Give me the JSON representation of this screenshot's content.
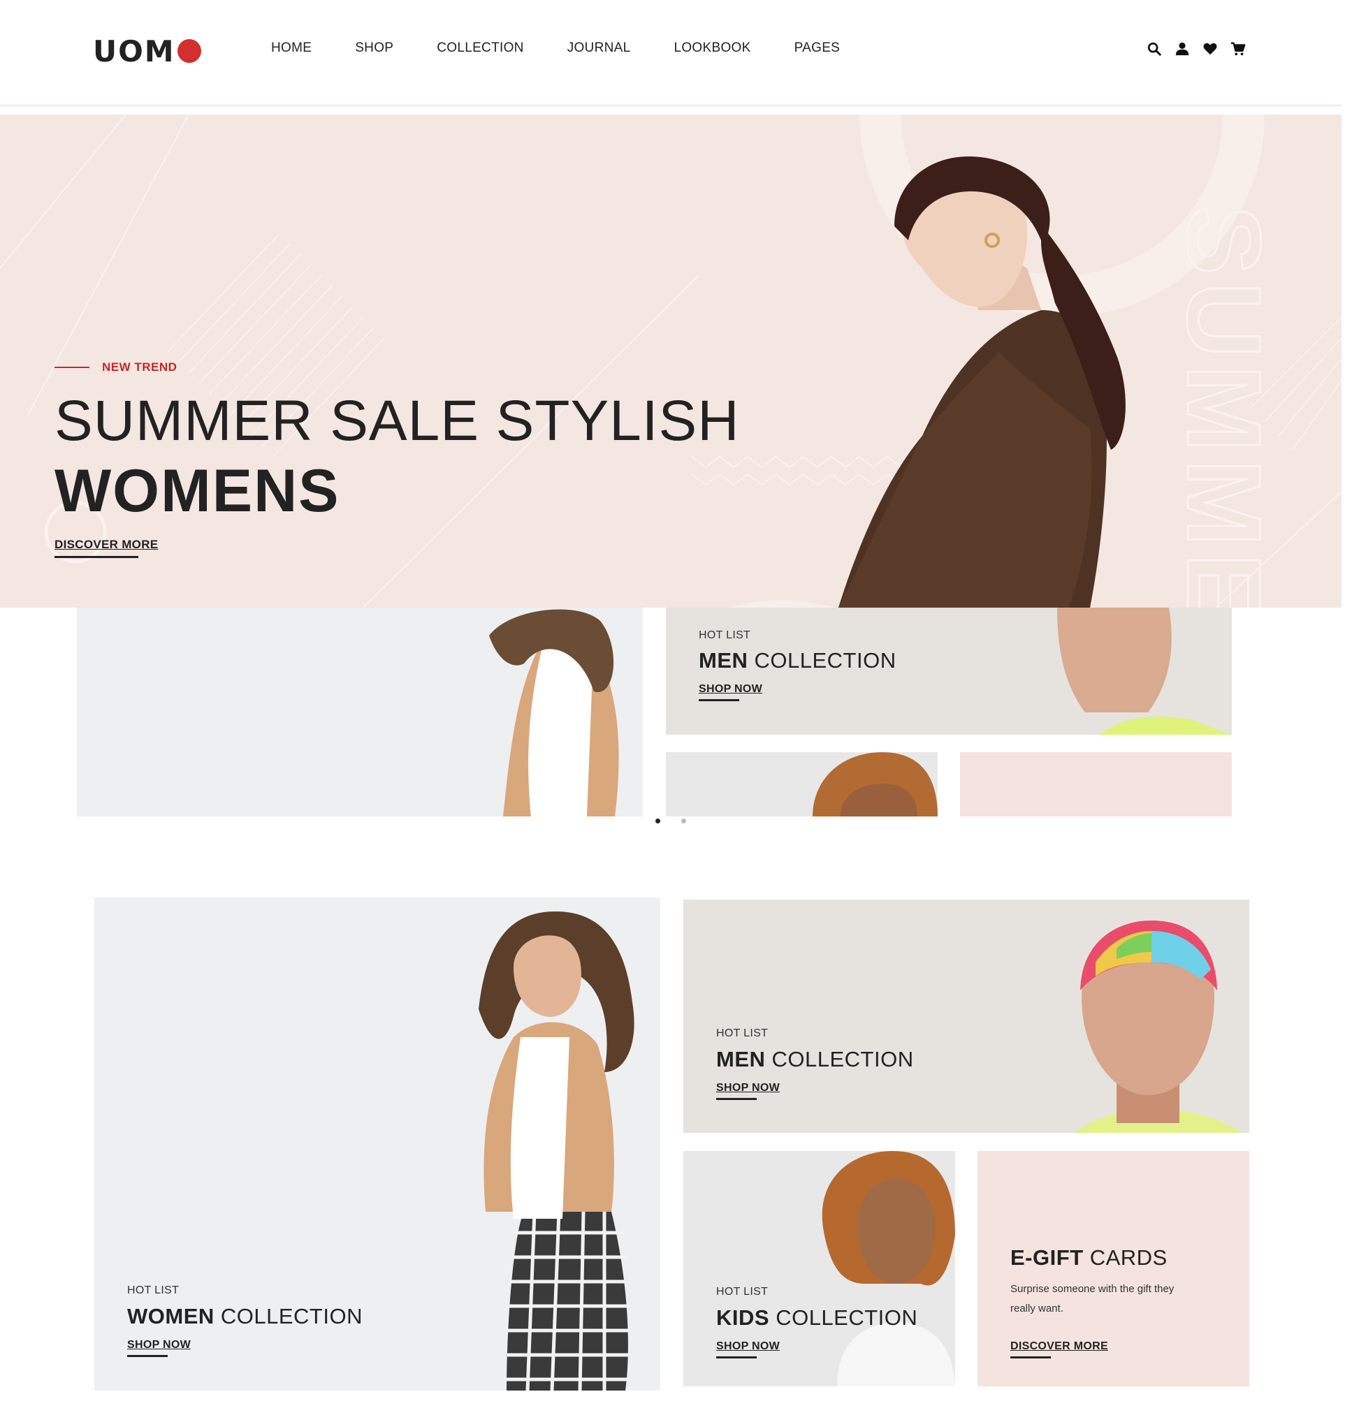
{
  "brand": {
    "logo_text": "UOM",
    "logo_dot_color": "#d32f2f"
  },
  "nav": {
    "items": [
      "HOME",
      "SHOP",
      "COLLECTION",
      "JOURNAL",
      "LOOKBOOK",
      "PAGES"
    ]
  },
  "header_icons": [
    "search-icon",
    "user-icon",
    "heart-icon",
    "cart-icon"
  ],
  "hero": {
    "eyebrow": "NEW TREND",
    "title_line1": "SUMMER SALE STYLISH",
    "title_line2": "WOMENS",
    "cta": "DISCOVER MORE",
    "watermark": "SUMMER",
    "background_color": "#f4e6e0",
    "accent_color": "#c62828"
  },
  "carousel": {
    "dot_count": 2,
    "active_index": 0
  },
  "preview_row": {
    "men": {
      "eyebrow": "HOT LIST",
      "title_bold": "MEN",
      "title_rest": " COLLECTION",
      "cta": "SHOP NOW"
    }
  },
  "collections": {
    "women": {
      "eyebrow": "HOT LIST",
      "title_bold": "WOMEN",
      "title_rest": " COLLECTION",
      "cta": "SHOP NOW"
    },
    "men": {
      "eyebrow": "HOT LIST",
      "title_bold": "MEN",
      "title_rest": " COLLECTION",
      "cta": "SHOP NOW"
    },
    "kids": {
      "eyebrow": "HOT LIST",
      "title_bold": "KIDS",
      "title_rest": " COLLECTION",
      "cta": "SHOP NOW"
    },
    "egift": {
      "title_bold": "E-GIFT",
      "title_rest": " CARDS",
      "description": "Surprise someone with the gift they really want.",
      "cta": "DISCOVER MORE"
    }
  },
  "colors": {
    "tile_gray": "#eeeff1",
    "tile_warm_gray": "#e6e3df",
    "tile_pink": "#f4e3de",
    "dot_active": "#222222",
    "dot_inactive": "#bbbbbb"
  }
}
